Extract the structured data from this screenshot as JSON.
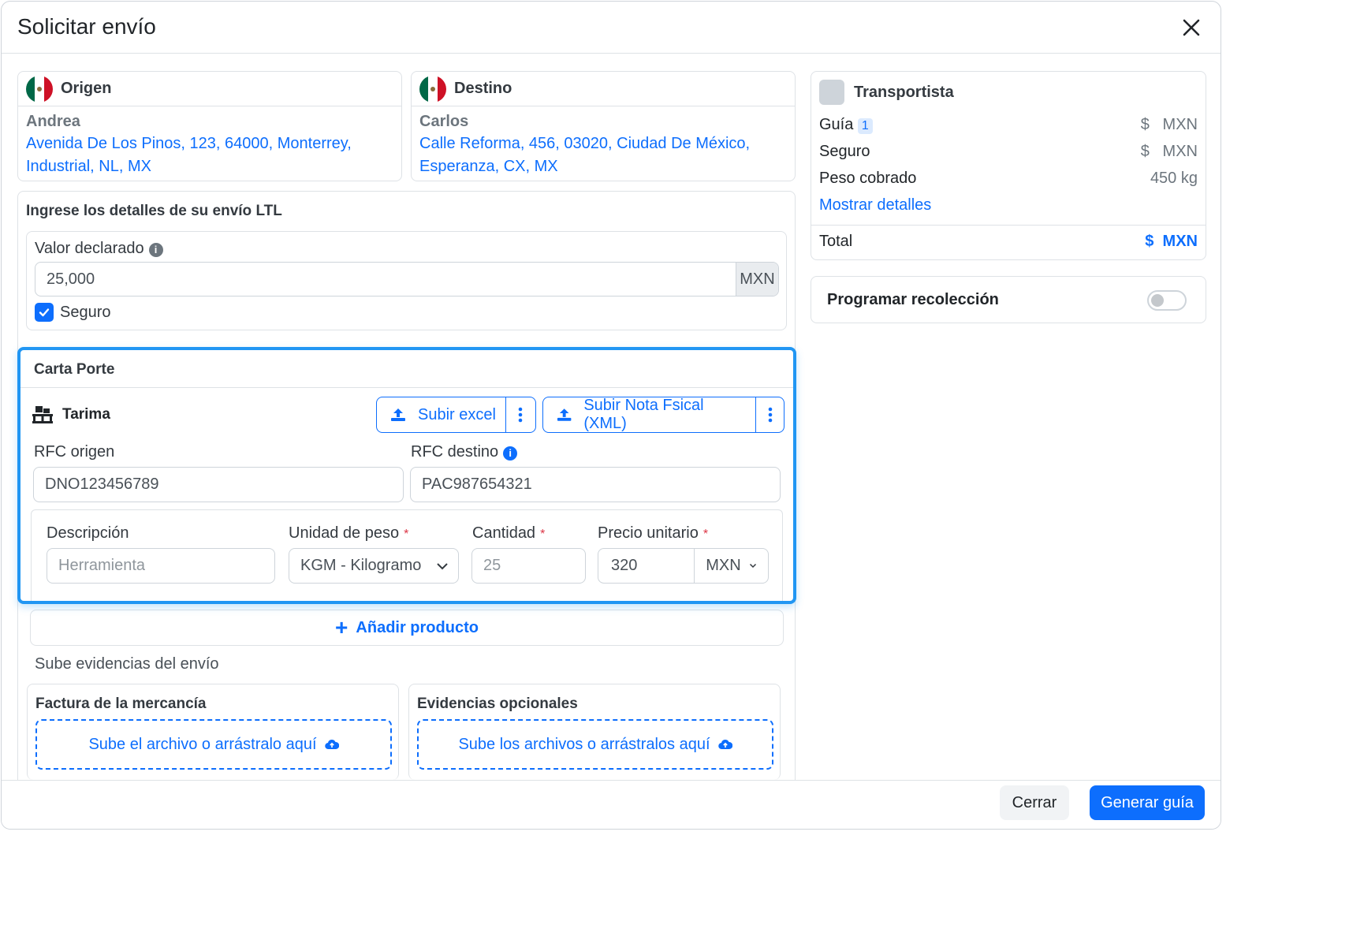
{
  "modal": {
    "title": "Solicitar envío"
  },
  "origin": {
    "label": "Origen",
    "name": "Andrea",
    "address_line1": "Avenida De Los Pinos, 123, 64000, Monterrey,",
    "address_line2": "Industrial, NL, MX"
  },
  "destination": {
    "label": "Destino",
    "name": "Carlos",
    "address_line1": "Calle Reforma, 456, 03020, Ciudad De México,",
    "address_line2": "Esperanza, CX, MX"
  },
  "ltl": {
    "title": "Ingrese los detalles de su envío LTL",
    "declared_value_label": "Valor declarado",
    "declared_value": "25,000",
    "currency": "MXN",
    "insurance_label": "Seguro"
  },
  "carta_porte": {
    "title": "Carta Porte",
    "package_label": "Tarima",
    "upload_excel": "Subir excel",
    "upload_xml": "Subir Nota Fsical (XML)",
    "rfc_origin_label": "RFC origen",
    "rfc_origin": "DNO123456789",
    "rfc_dest_label": "RFC destino",
    "rfc_dest": "PAC987654321",
    "description_label": "Descripción",
    "description_placeholder": "Herramienta",
    "weight_unit_label": "Unidad de peso",
    "weight_unit": "KGM - Kilogramo",
    "quantity_label": "Cantidad",
    "quantity_placeholder": "25",
    "unit_price_label": "Precio unitario",
    "unit_price": "320",
    "price_currency": "MXN",
    "required_mark": "*"
  },
  "add_product": "Añadir producto",
  "evidence": {
    "title": "Sube evidencias del envío",
    "invoice_title": "Factura de la mercancía",
    "invoice_drop": "Sube el archivo o arrástralo aquí",
    "optional_title": "Evidencias opcionales",
    "optional_drop": "Sube los archivos o arrástralos aquí"
  },
  "carrier": {
    "title": "Transportista",
    "guide_label": "Guía",
    "guide_badge": "1",
    "guide_value_symbol": "$",
    "guide_value_currency": "MXN",
    "insurance_label": "Seguro",
    "insurance_value_symbol": "$",
    "insurance_value_currency": "MXN",
    "weight_label": "Peso cobrado",
    "weight_value": "450 kg",
    "show_details": "Mostrar detalles",
    "total_label": "Total",
    "total_symbol": "$",
    "total_currency": "MXN"
  },
  "schedule": {
    "label": "Programar recolección",
    "enabled": false
  },
  "footer": {
    "cancel": "Cerrar",
    "submit": "Generar guía"
  },
  "colors": {
    "accent": "#0d6efd",
    "highlight": "#2196f3",
    "danger": "#dc3545"
  }
}
